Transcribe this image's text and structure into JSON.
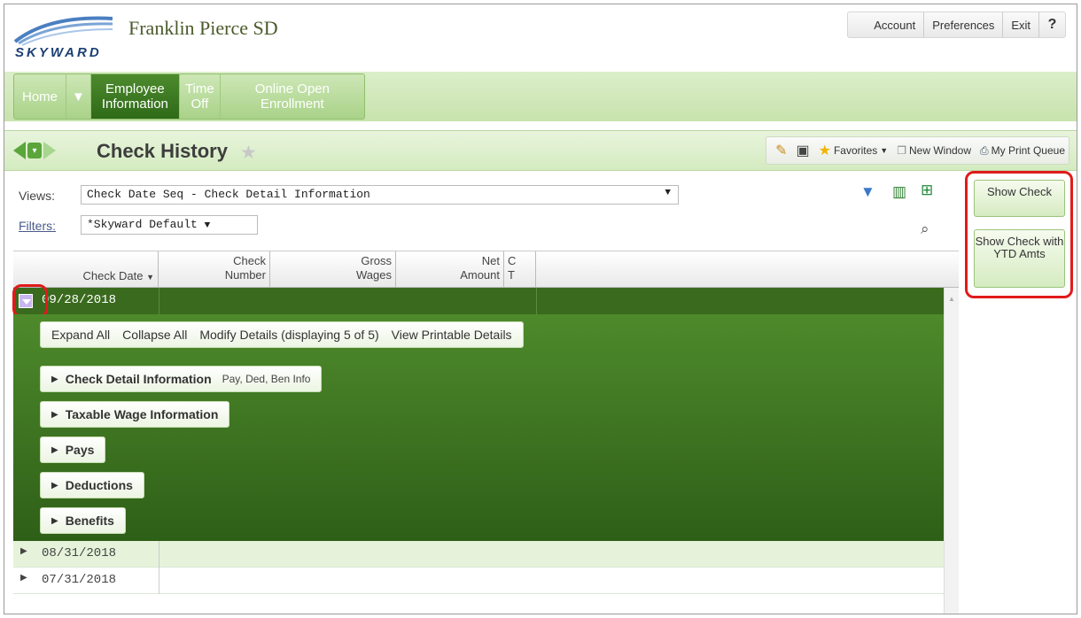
{
  "app": {
    "logo_text": "SKYWARD",
    "district_name": "Franklin Pierce SD"
  },
  "top_nav": [
    "Account",
    "Preferences",
    "Exit",
    "?"
  ],
  "tabs": [
    {
      "label": "Home",
      "active": false
    },
    {
      "label": "Employee Information",
      "active": true
    },
    {
      "label": "Time Off",
      "active": false
    },
    {
      "label": "Online Open Enrollment",
      "active": false
    }
  ],
  "page": {
    "title": "Check History",
    "toolbar": {
      "favorites": "Favorites",
      "new_window": "New Window",
      "print_queue": "My Print Queue"
    }
  },
  "views": {
    "label": "Views:",
    "value": "Check Date Seq - Check Detail Information",
    "filters_label": "Filters:",
    "filters_value": "*Skyward Default"
  },
  "side_buttons": {
    "show_check": "Show Check",
    "show_check_ytd": "Show Check with YTD Amts"
  },
  "grid": {
    "columns": [
      "Check Date",
      "Check Number",
      "Gross Wages",
      "Net Amount",
      "C T"
    ],
    "selected_row": "09/28/2018",
    "detail_links": [
      "Expand All",
      "Collapse All",
      "Modify Details (displaying 5 of 5)",
      "View Printable Details"
    ],
    "sections": [
      {
        "label": "Check Detail Information",
        "sub": "Pay, Ded, Ben Info"
      },
      {
        "label": "Taxable Wage Information",
        "sub": ""
      },
      {
        "label": "Pays",
        "sub": ""
      },
      {
        "label": "Deductions",
        "sub": ""
      },
      {
        "label": "Benefits",
        "sub": ""
      }
    ],
    "other_rows": [
      "08/31/2018",
      "07/31/2018"
    ]
  }
}
